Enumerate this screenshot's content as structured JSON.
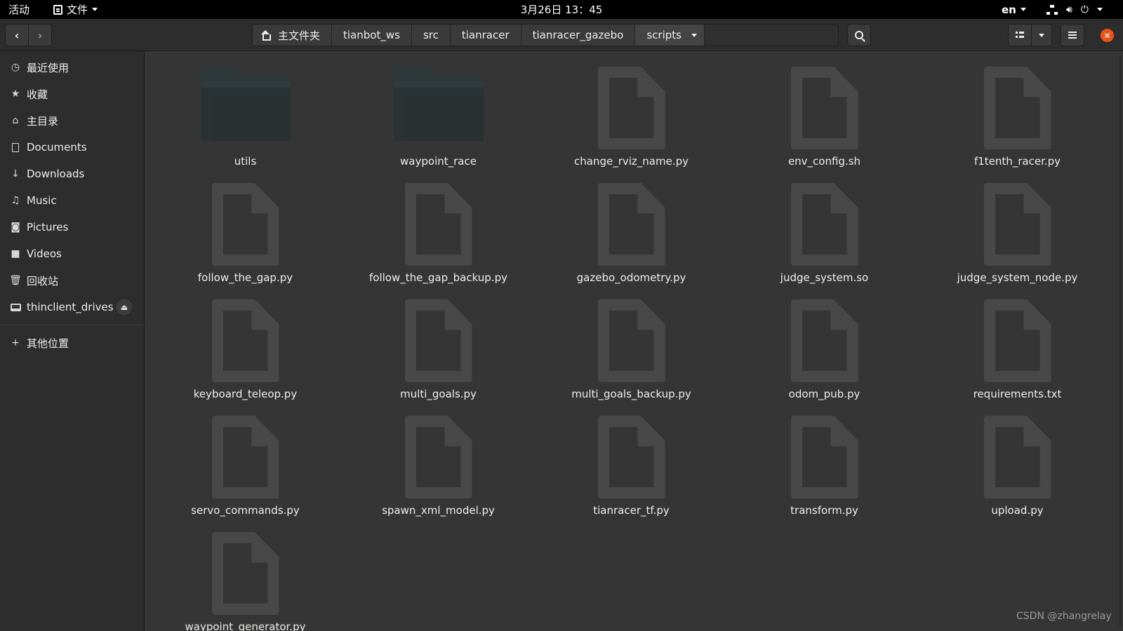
{
  "topbar": {
    "activities": "活动",
    "app_menu": "文件",
    "clock": "3月26日 13：45",
    "lang": "en"
  },
  "header": {
    "path": [
      "主文件夹",
      "tianbot_ws",
      "src",
      "tianracer",
      "tianracer_gazebo",
      "scripts"
    ],
    "close_glyph": "✕"
  },
  "sidebar": {
    "items": [
      {
        "label": "最近使用",
        "icon": "clock-icon"
      },
      {
        "label": "收藏",
        "icon": "star-icon"
      },
      {
        "label": "主目录",
        "icon": "home-icon"
      },
      {
        "label": "Documents",
        "icon": "document-icon"
      },
      {
        "label": "Downloads",
        "icon": "download-icon"
      },
      {
        "label": "Music",
        "icon": "music-icon"
      },
      {
        "label": "Pictures",
        "icon": "camera-icon"
      },
      {
        "label": "Videos",
        "icon": "video-icon"
      },
      {
        "label": "回收站",
        "icon": "trash-icon"
      }
    ],
    "drive": {
      "label": "thinclient_drives",
      "icon": "drive-icon"
    },
    "other": {
      "label": "其他位置",
      "icon": "plus-icon"
    }
  },
  "files": [
    {
      "name": "utils",
      "type": "folder"
    },
    {
      "name": "waypoint_race",
      "type": "folder"
    },
    {
      "name": "change_rviz_name.py",
      "type": "file"
    },
    {
      "name": "env_config.sh",
      "type": "file"
    },
    {
      "name": "f1tenth_racer.py",
      "type": "file"
    },
    {
      "name": "follow_the_gap.py",
      "type": "file"
    },
    {
      "name": "follow_the_gap_backup.py",
      "type": "file"
    },
    {
      "name": "gazebo_odometry.py",
      "type": "file"
    },
    {
      "name": "judge_system.so",
      "type": "file"
    },
    {
      "name": "judge_system_node.py",
      "type": "file"
    },
    {
      "name": "keyboard_teleop.py",
      "type": "file"
    },
    {
      "name": "multi_goals.py",
      "type": "file"
    },
    {
      "name": "multi_goals_backup.py",
      "type": "file"
    },
    {
      "name": "odom_pub.py",
      "type": "file"
    },
    {
      "name": "requirements.txt",
      "type": "file"
    },
    {
      "name": "servo_commands.py",
      "type": "file"
    },
    {
      "name": "spawn_xml_model.py",
      "type": "file"
    },
    {
      "name": "tianracer_tf.py",
      "type": "file"
    },
    {
      "name": "transform.py",
      "type": "file"
    },
    {
      "name": "upload.py",
      "type": "file"
    },
    {
      "name": "waypoint_generator.py",
      "type": "file"
    }
  ],
  "watermark": "CSDN @zhangrelay",
  "colors": {
    "close_button": "#e9541e",
    "folder": "#2e3739",
    "file_icon": "#484848"
  }
}
